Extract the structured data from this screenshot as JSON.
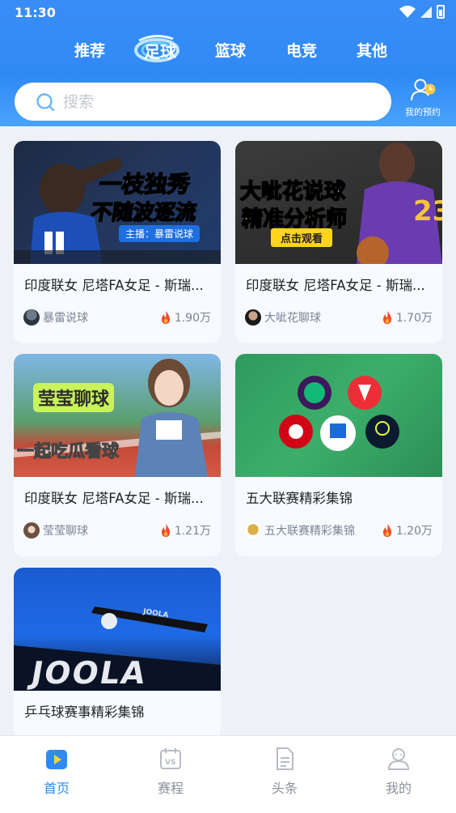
{
  "status": {
    "time": "11:30"
  },
  "tabs": [
    {
      "label": "推荐"
    },
    {
      "label": "足球",
      "active": true
    },
    {
      "label": "篮球"
    },
    {
      "label": "电竞"
    },
    {
      "label": "其他"
    }
  ],
  "search": {
    "placeholder": "搜索"
  },
  "reservation": {
    "label": "我的预约"
  },
  "cards": [
    {
      "title": "印度联女 尼塔FA女足 - 斯瑞...",
      "author": "暴雷说球",
      "views": "1.90万",
      "thumb_text": [
        "一枝独秀",
        "不随波逐流",
        "主播：暴雷说球"
      ]
    },
    {
      "title": "印度联女 尼塔FA女足 - 斯瑞...",
      "author": "大呲花聊球",
      "views": "1.70万",
      "thumb_text": [
        "大呲花说球",
        "精准分析师",
        "点击观看"
      ]
    },
    {
      "title": "印度联女 尼塔FA女足 - 斯瑞...",
      "author": "莹莹聊球",
      "views": "1.21万",
      "thumb_text": [
        "莹莹聊球",
        "一起吃瓜看球"
      ]
    },
    {
      "title": "五大联赛精彩集锦",
      "author": "五大联赛精彩集锦",
      "views": "1.20万"
    },
    {
      "title": "乒乓球赛事精彩集锦",
      "author": "",
      "views": "",
      "thumb_text": [
        "JOOLA",
        "JOOLA"
      ]
    }
  ],
  "nav": [
    {
      "label": "首页",
      "active": true
    },
    {
      "label": "赛程"
    },
    {
      "label": "头条"
    },
    {
      "label": "我的"
    }
  ],
  "colors": {
    "accent": "#2f8af5",
    "fire": "#f24b2a"
  }
}
